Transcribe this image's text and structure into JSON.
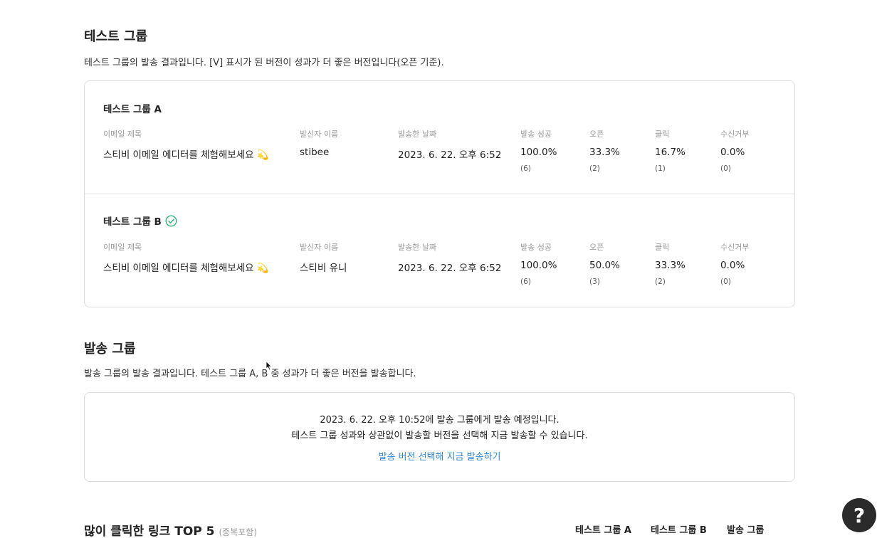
{
  "test_section": {
    "title": "테스트 그룹",
    "description": "테스트 그룹의 발송 결과입니다. [V] 표시가 된 버전이 성과가 더 좋은 버전입니다(오픈 기준)."
  },
  "columns": {
    "subject": "이메일 제목",
    "sender": "발신자 이름",
    "sent_date": "발송한 날짜",
    "success": "발송 성공",
    "open": "오픈",
    "click": "클릭",
    "unsubscribe": "수신거부"
  },
  "groups": [
    {
      "name": "테스트 그룹 A",
      "winner": false,
      "subject": "스티비 이메일 에디터를 체험해보세요 💫",
      "sender": "stibee",
      "sent_date": "2023. 6. 22. 오후 6:52",
      "success": "100.0%",
      "success_count": "(6)",
      "open": "33.3%",
      "open_count": "(2)",
      "click": "16.7%",
      "click_count": "(1)",
      "unsubscribe": "0.0%",
      "unsubscribe_count": "(0)"
    },
    {
      "name": "테스트 그룹 B",
      "winner": true,
      "subject": "스티비 이메일 에디터를 체험해보세요 💫",
      "sender": "스티비 유니",
      "sent_date": "2023. 6. 22. 오후 6:52",
      "success": "100.0%",
      "success_count": "(6)",
      "open": "50.0%",
      "open_count": "(3)",
      "click": "33.3%",
      "click_count": "(2)",
      "unsubscribe": "0.0%",
      "unsubscribe_count": "(0)"
    }
  ],
  "send_section": {
    "title": "발송 그룹",
    "description": "발송 그룹의 발송 결과입니다. 테스트 그룹 A, B 중 성과가 더 좋은 버전을 발송합니다.",
    "notice_line1": "2023. 6. 22. 오후 10:52에 발송 그룹에게 발송 예정입니다.",
    "notice_line2": "테스트 그룹 성과와 상관없이 발송할 버전을 선택해 지금 발송할 수 있습니다.",
    "action_link": "발송 버전 선택해 지금 발송하기"
  },
  "top5": {
    "title": "많이 클릭한 링크 TOP 5",
    "subtitle": "(중복포함)",
    "col_a": "테스트 그룹 A",
    "col_b": "테스트 그룹 B",
    "col_send": "발송 그룹"
  },
  "help": {
    "label": "?"
  },
  "colors": {
    "accent_link": "#2f86d6",
    "winner_check": "#2fb47d"
  },
  "icons": {
    "winner": "check-circle-icon",
    "help": "question-icon"
  }
}
